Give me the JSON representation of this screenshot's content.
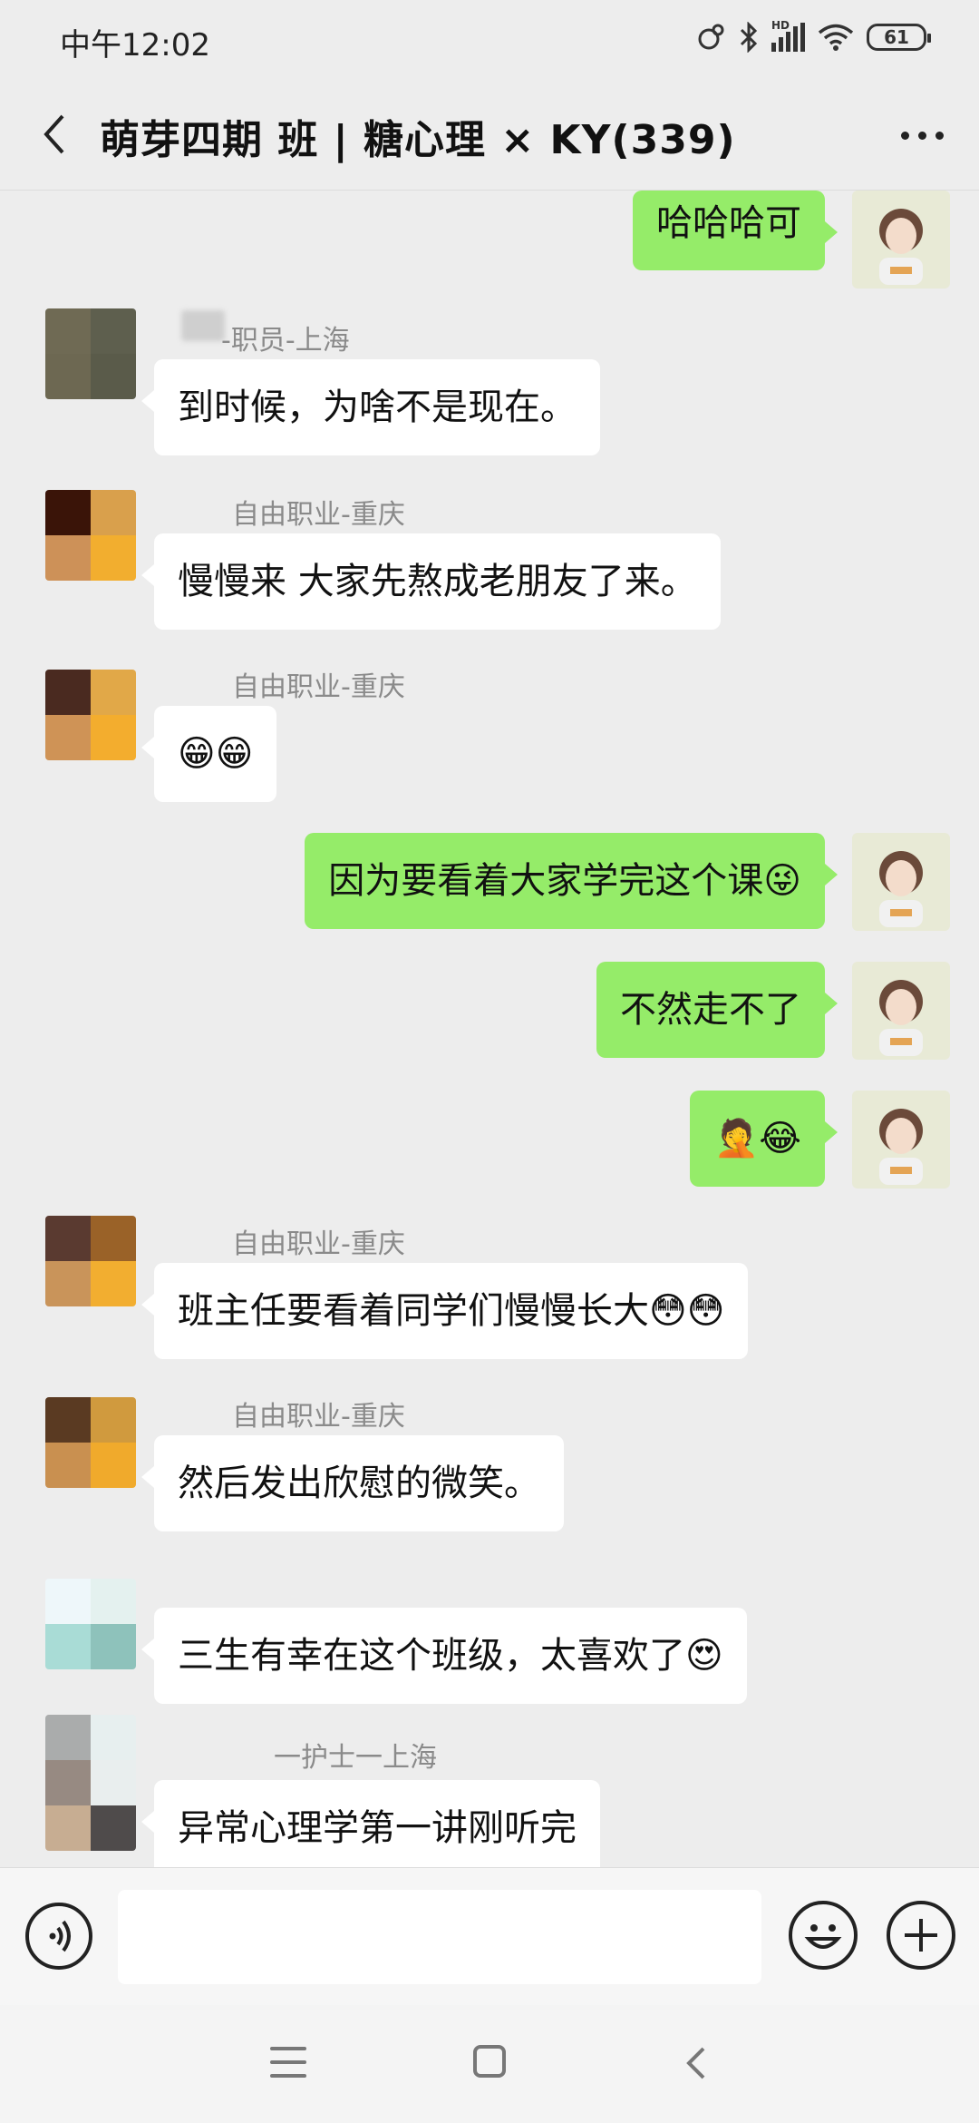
{
  "status_bar": {
    "time": "中午12:02",
    "battery": "61",
    "hd": "HD"
  },
  "header": {
    "title": "萌芽四期  班 | 糖心理 × KY(339)"
  },
  "colors": {
    "outgoing_bubble": "#95ec69",
    "incoming_bubble": "#ffffff",
    "background": "#ededed"
  },
  "messages": [
    {
      "direction": "out",
      "text": "哈哈哈可"
    },
    {
      "direction": "in",
      "sender": "-职员-上海",
      "text": "到时候，为啥不是现在。"
    },
    {
      "direction": "in",
      "sender": "自由职业-重庆",
      "text": "慢慢来 大家先熬成老朋友了来。"
    },
    {
      "direction": "in",
      "sender": "自由职业-重庆",
      "text": "😁😁"
    },
    {
      "direction": "out",
      "text": "因为要看着大家学完这个课😜"
    },
    {
      "direction": "out",
      "text": "不然走不了"
    },
    {
      "direction": "out",
      "text": "🤦😂"
    },
    {
      "direction": "in",
      "sender": "自由职业-重庆",
      "text": "班主任要看着同学们慢慢长大😳😳"
    },
    {
      "direction": "in",
      "sender": "自由职业-重庆",
      "text": "然后发出欣慰的微笑。"
    },
    {
      "direction": "in",
      "sender": "",
      "text": "三生有幸在这个班级，太喜欢了😍"
    },
    {
      "direction": "in",
      "sender": "一护士一上海",
      "text": "异常心理学第一讲刚听完"
    }
  ],
  "input": {
    "value": "",
    "placeholder": ""
  },
  "icons": {
    "back": "chevron-left-icon",
    "more": "more-dots-icon",
    "voice": "voice-icon",
    "emoji": "smiley-icon",
    "plus": "plus-icon"
  }
}
